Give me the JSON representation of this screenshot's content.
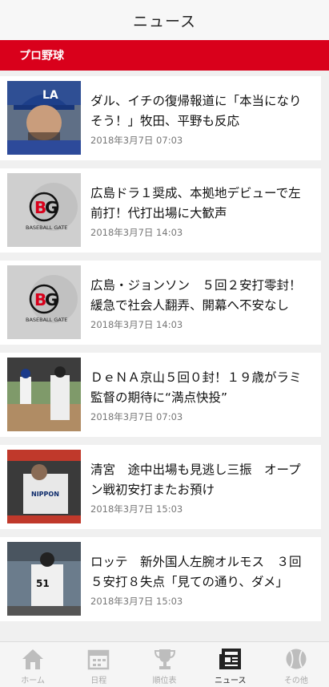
{
  "header": {
    "title": "ニュース"
  },
  "section": {
    "label": "プロ野球"
  },
  "articles": [
    {
      "headline": "ダル、イチの復帰報道に「本当になりそう！」牧田、平野も反応",
      "date": "2018年3月7日 07:03"
    },
    {
      "headline": "広島ドラ１奨成、本拠地デビューで左前打！代打出場に大歓声",
      "date": "2018年3月7日 14:03"
    },
    {
      "headline": "広島・ジョンソン　５回２安打零封！緩急で社会人翻弄、開幕へ不安なし",
      "date": "2018年3月7日 14:03"
    },
    {
      "headline": "ＤｅＮＡ京山５回０封！１９歳がラミ監督の期待に“満点快投”",
      "date": "2018年3月7日 07:03"
    },
    {
      "headline": "清宮　途中出場も見逃し三振　オープン戦初安打またお預け",
      "date": "2018年3月7日 15:03"
    },
    {
      "headline": "ロッテ　新外国人左腕オルモス　３回５安打８失点「見ての通り、ダメ」",
      "date": "2018年3月7日 15:03"
    }
  ],
  "tabs": [
    {
      "label": "ホーム",
      "icon": "home-icon"
    },
    {
      "label": "日程",
      "icon": "calendar-icon"
    },
    {
      "label": "順位表",
      "icon": "trophy-icon"
    },
    {
      "label": "ニュース",
      "icon": "news-icon",
      "active": true
    },
    {
      "label": "その他",
      "icon": "baseball-icon"
    }
  ],
  "colors": {
    "accent": "#d9001b",
    "active_tab": "#222222",
    "inactive_tab": "#aaaaaa"
  }
}
